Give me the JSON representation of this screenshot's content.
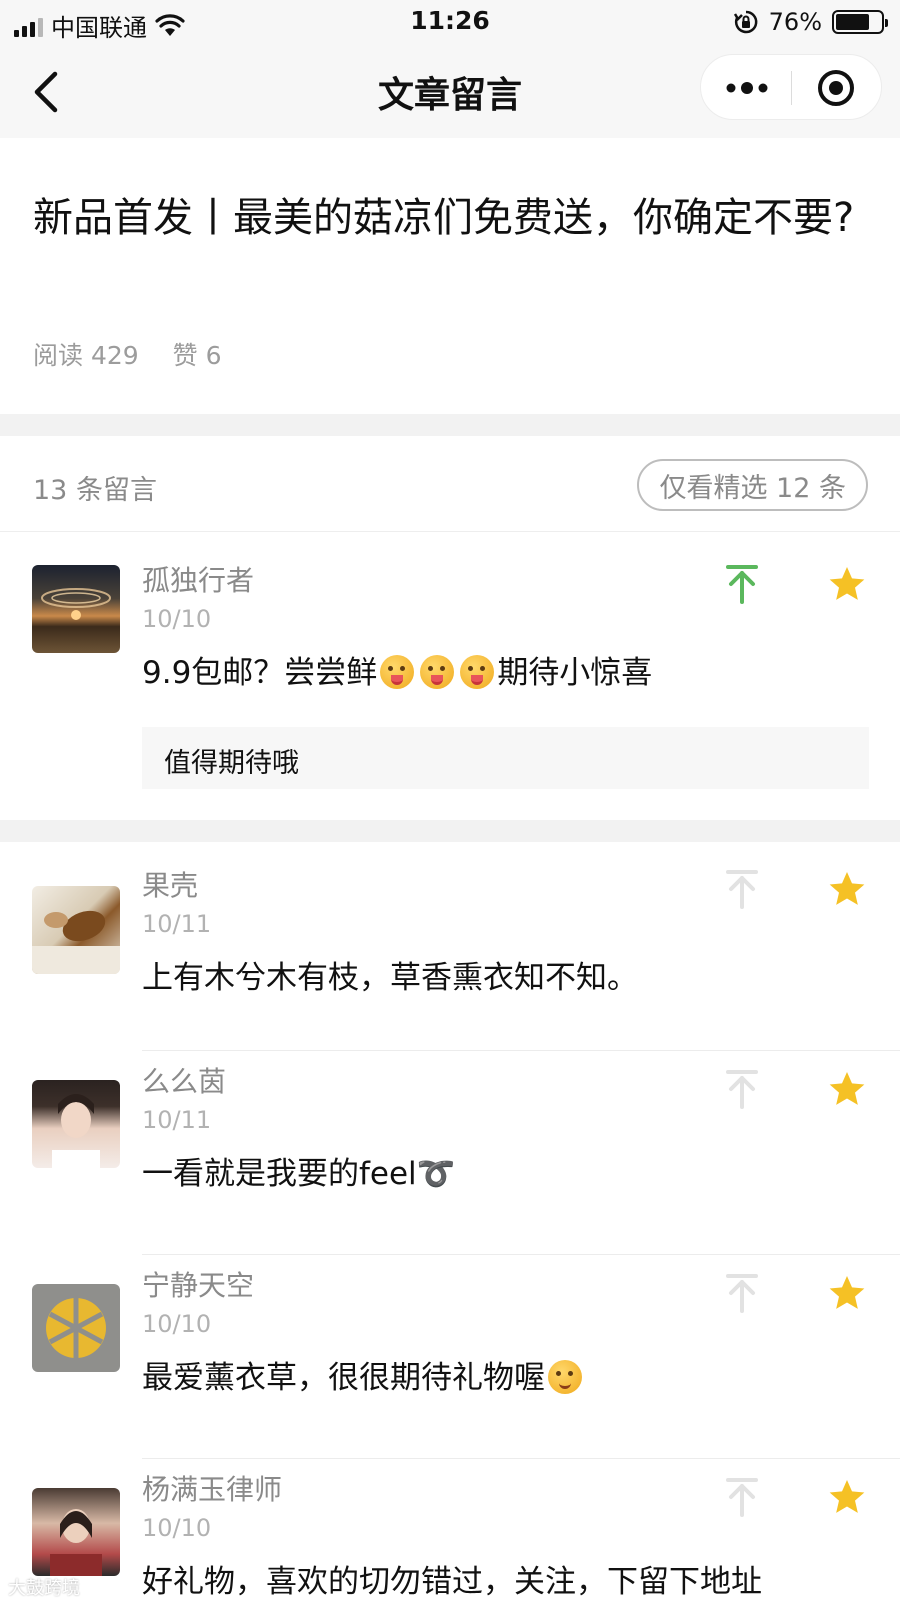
{
  "status_bar": {
    "carrier": "中国联通",
    "time": "11:26",
    "battery": "76%",
    "battery_level": 0.76
  },
  "nav": {
    "title": "文章留言",
    "back_icon": "chevron-left-icon",
    "more_icon": "more-dots-icon",
    "close_icon": "target-icon"
  },
  "article": {
    "title": "新品首发丨最美的菇凉们免费送，你确定不要?",
    "reads": "阅读 429",
    "likes": "赞 6"
  },
  "comments_header": {
    "count": "13 条留言",
    "filter_button": "仅看精选 12 条"
  },
  "comments": [
    {
      "nickname": "孤独行者",
      "date": "10/10",
      "text_before_emoji": "9.9包邮？尝尝鲜",
      "text_after_emoji": "期待小惊喜",
      "reply": "值得期待哦",
      "pinned": true,
      "starred": true
    },
    {
      "nickname": "果壳",
      "date": "10/11",
      "text": "上有木兮木有枝，草香熏衣知不知。",
      "pinned": false,
      "starred": true
    },
    {
      "nickname": "么么茵",
      "date": "10/11",
      "text": "一看就是我要的feel➰",
      "pinned": false,
      "starred": true
    },
    {
      "nickname": "宁静天空",
      "date": "10/10",
      "text": "最爱薰衣草，很很期待礼物喔",
      "pinned": false,
      "starred": true
    },
    {
      "nickname": "杨满玉律师",
      "date": "10/10",
      "text": "好礼物，喜欢的切勿错过，关注，下留下地址",
      "pinned": false,
      "starred": true
    }
  ],
  "colors": {
    "pin_active": "#5bb85d",
    "pin_inactive": "#e2e2e2",
    "star": "#f5c125",
    "gray_text": "#8a8a8a"
  },
  "watermark": "大鼓跨境"
}
